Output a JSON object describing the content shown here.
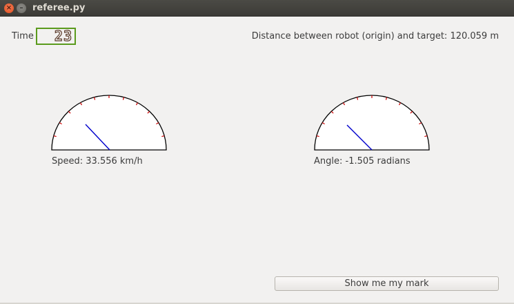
{
  "window": {
    "title": "referee.py",
    "close_glyph": "×",
    "min_glyph": "–"
  },
  "time": {
    "label": "Time",
    "value": "23"
  },
  "distance": {
    "text": "Distance between robot (origin) and target: 120.059 m"
  },
  "speed_gauge": {
    "label": "Speed: 33.556 km/h",
    "needle_color": "#0000cc",
    "tick_color": "#cc0000"
  },
  "angle_gauge": {
    "label": "Angle: -1.505 radians",
    "needle_color": "#0000cc",
    "tick_color": "#cc0000"
  },
  "actions": {
    "show_mark_label": "Show me my mark"
  }
}
